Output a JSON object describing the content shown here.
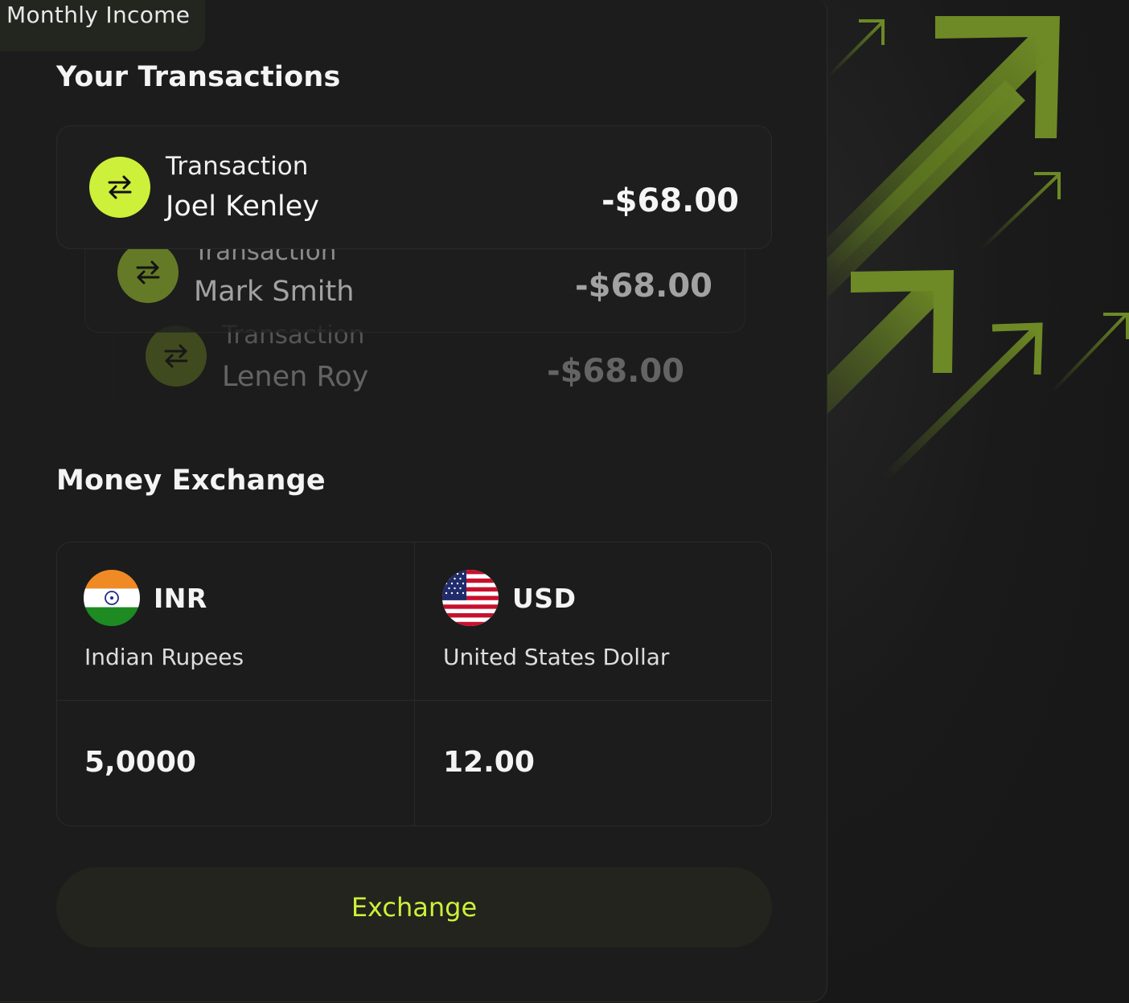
{
  "tab": {
    "label": "Monthly Income"
  },
  "transactions": {
    "title": "Your Transactions",
    "items": [
      {
        "type": "Transaction",
        "name": "Joel Kenley",
        "amount": "-$68.00"
      },
      {
        "type": "Transaction",
        "name": "Mark Smith",
        "amount": "-$68.00"
      },
      {
        "type": "Transaction",
        "name": "Lenen Roy",
        "amount": "-$68.00"
      }
    ]
  },
  "exchange": {
    "title": "Money Exchange",
    "from": {
      "code": "INR",
      "name": "Indian Rupees",
      "amount": "5,0000",
      "flag_icon": "india-flag-icon"
    },
    "to": {
      "code": "USD",
      "name": "United States Dollar",
      "amount": "12.00",
      "flag_icon": "us-flag-icon"
    },
    "button_label": "Exchange"
  },
  "colors": {
    "accent": "#cdf03a",
    "arrow": "#6e8a26",
    "background": "#181818"
  }
}
